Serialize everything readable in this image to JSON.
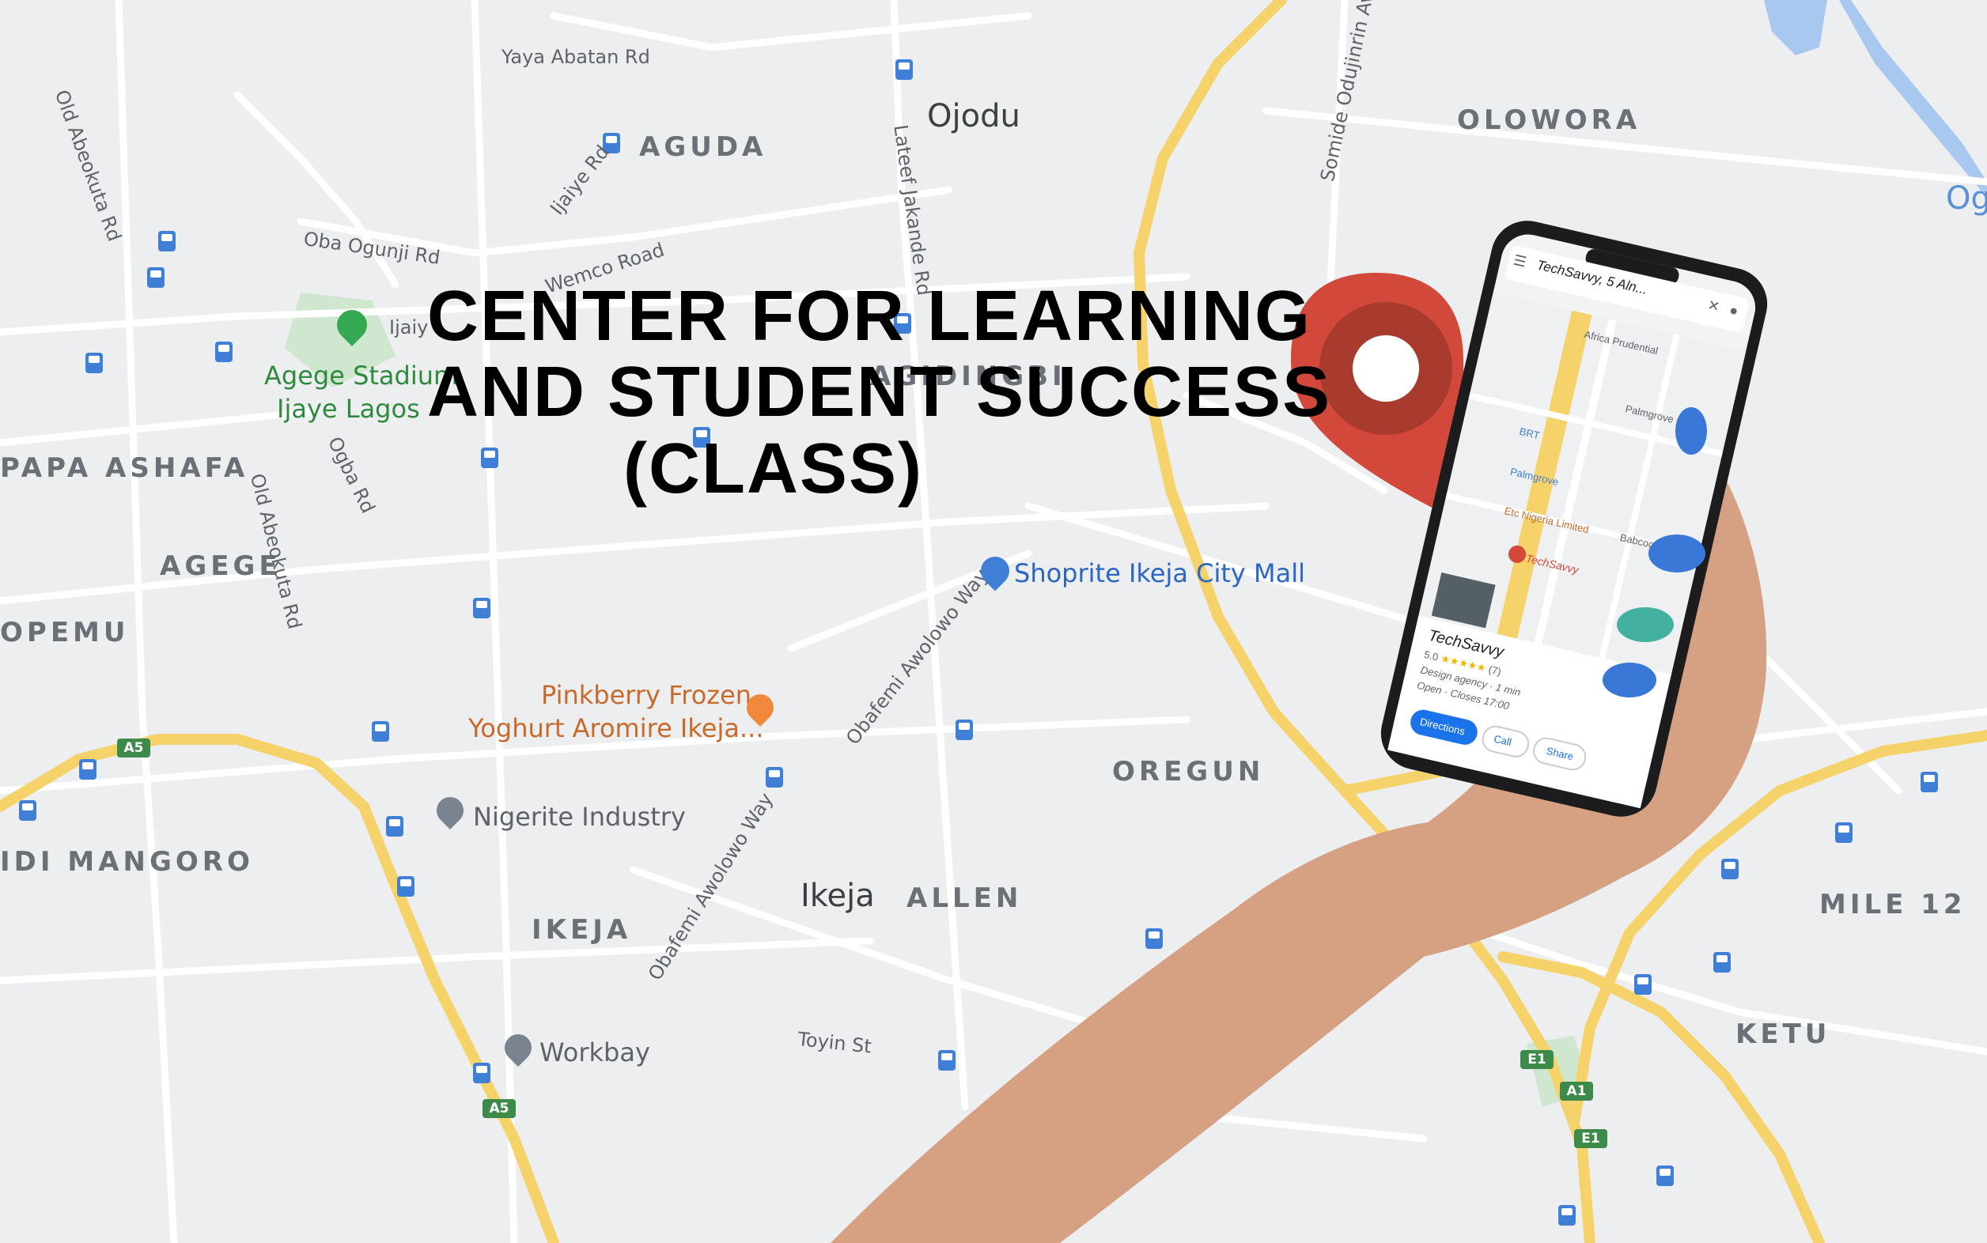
{
  "headline": {
    "line1": "CENTER FOR LEARNING",
    "line2": "AND STUDENT SUCCESS",
    "line3": "(CLASS)"
  },
  "map_labels": {
    "areas": {
      "aguda": "AGUDA",
      "olowora": "OLOWORA",
      "agidingbi": "AGIDINGBI",
      "papa_ashafa": "PAPA ASHAFA",
      "agege": "AGEGE",
      "opemu": "OPEMU",
      "oregun": "OREGUN",
      "idi_mangoro": "IDI MANGORO",
      "ikeja_district": "IKEJA",
      "allen": "ALLEN",
      "mile_12": "MILE 12",
      "ketu": "KETU"
    },
    "towns": {
      "ojodu": "Ojodu",
      "ikeja": "Ikeja"
    },
    "roads": {
      "yaya_abatan": "Yaya Abatan Rd",
      "old_abeokuta_1": "Old Abeokuta Rd",
      "old_abeokuta_2": "Old Abeokuta Rd",
      "ijaiye": "Ijaiye Rd",
      "oba_ogunji": "Oba Ogunji Rd",
      "wemco": "Wemco Road",
      "lateef_jakande": "Lateef Jakande Rd",
      "somide": "Somide Odujinrin Av",
      "ogba": "Ogba Rd",
      "awolowo_1": "Obafemi Awolowo Way",
      "awolowo_2": "Obafemi Awolowo Way",
      "awolowo_3": "Obafemi Awolowo Way",
      "toyin": "Toyin St",
      "ijaiye_partial": "Ijaiy",
      "ogba_partial": "OGBA"
    },
    "pois": {
      "agege_stadium_1": "Agege Stadium",
      "agege_stadium_2": "Ijaye Lagos",
      "shoprite": "Shoprite Ikeja City Mall",
      "pinkberry_1": "Pinkberry Frozen",
      "pinkberry_2": "Yoghurt Aromire Ikeja...",
      "nigerite": "Nigerite Industry",
      "workbay": "Workbay"
    },
    "highways": {
      "a5_top": "A5",
      "a5_bottom": "A5",
      "e1_top": "E1",
      "a1": "A1",
      "e1_bottom": "E1"
    },
    "partial": {
      "ogu": "Ogu"
    }
  },
  "phone": {
    "search_text": "TechSavvy, 5 Aln...",
    "place_name": "TechSavvy",
    "rating": "5.0",
    "stars": "★★★★★",
    "reviews": "(7)",
    "category": "Design agency · 1 min",
    "hours": "Open · Closes 17:00",
    "pin_label": "TechSavvy",
    "map_labels": {
      "africa_prudential": "Africa Prudential",
      "palmgrove_1": "Palmgrove",
      "palmgrove_2": "Palmgrove",
      "brt": "BRT",
      "etc": "Etc Nigeria Limited",
      "babcock": "Babcoc"
    },
    "buttons": {
      "directions": "Directions",
      "call": "Call",
      "share": "Share"
    }
  },
  "colors": {
    "map_background": "#eceeef",
    "major_road": "#f6d36a",
    "minor_road": "#ffffff",
    "water": "#a9c8ef",
    "park": "#c8e6c9",
    "pin": "#d2483a",
    "pin_inner": "#a83a2e",
    "highway_badge": "#3d8b4a",
    "bus_icon": "#3f7fd6"
  }
}
